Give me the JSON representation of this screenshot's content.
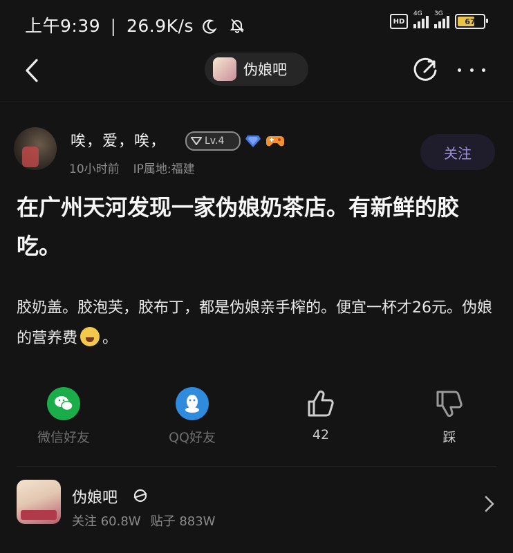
{
  "status_bar": {
    "time": "上午9:39",
    "speed": "26.9K/s",
    "network1": "4G",
    "network2": "3G",
    "hd": "HD",
    "battery": "67"
  },
  "nav": {
    "forum_name": "伪娘吧"
  },
  "post": {
    "author": "唉，爱，唉，",
    "level": "Lv.4",
    "time_ago": "10小时前",
    "ip_location": "IP属地:福建",
    "follow_label": "关注",
    "title": "在广州天河发现一家伪娘奶茶店。有新鲜的胶吃。",
    "body_part1": "胶奶盖。胶泡芙，胶布丁，都是伪娘亲手榨的。便宜一杯才26元。伪娘的营养费",
    "body_part2": "。"
  },
  "actions": {
    "wechat_label": "微信好友",
    "qq_label": "QQ好友",
    "like_count": "42",
    "dislike_label": "踩"
  },
  "forum_card": {
    "name": "伪娘吧",
    "followers": "关注 60.8W",
    "posts": "贴子 883W"
  },
  "colors": {
    "background": "#141414",
    "follow_text": "#9c8fd6",
    "wechat": "#1aad4a",
    "qq": "#2f8bde",
    "battery": "#e9c34a"
  }
}
